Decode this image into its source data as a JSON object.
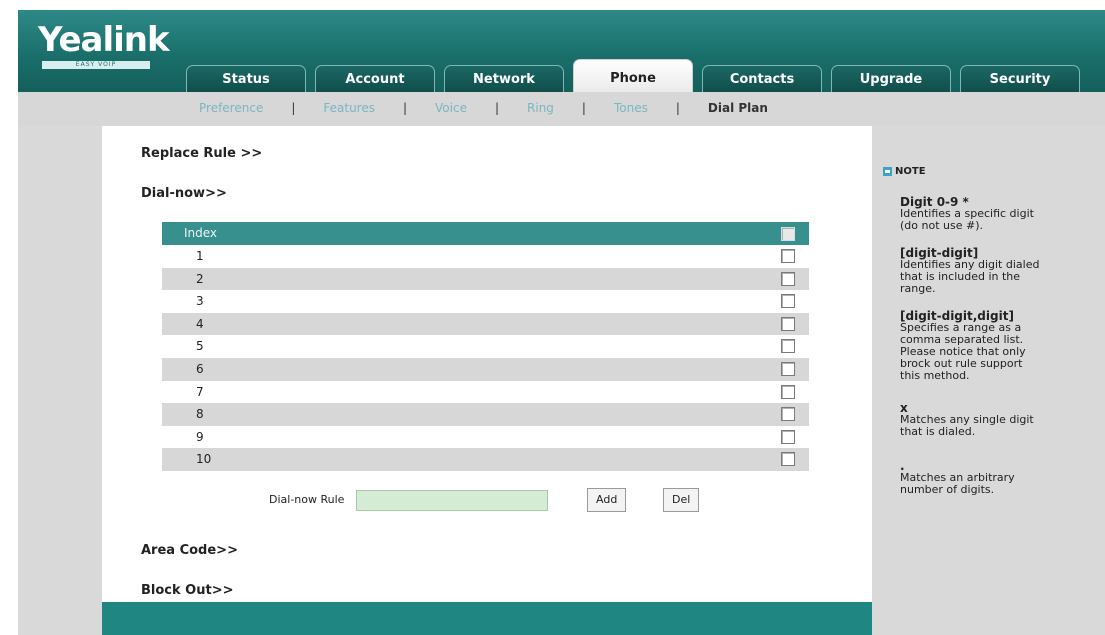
{
  "brand": {
    "logo": "Yealink",
    "tagline": "EASY VOIP"
  },
  "tabs": [
    {
      "label": "Status",
      "active": false
    },
    {
      "label": "Account",
      "active": false
    },
    {
      "label": "Network",
      "active": false
    },
    {
      "label": "Phone",
      "active": true
    },
    {
      "label": "Contacts",
      "active": false
    },
    {
      "label": "Upgrade",
      "active": false
    },
    {
      "label": "Security",
      "active": false
    }
  ],
  "subnav": {
    "items": [
      "Preference",
      "Features",
      "Voice",
      "Ring",
      "Tones",
      "Dial Plan"
    ],
    "separator": "|",
    "active": "Dial Plan"
  },
  "sections": {
    "replace_rule": "Replace Rule >>",
    "dial_now": "Dial-now>>",
    "area_code": "Area Code>>",
    "block_out": "Block Out>>"
  },
  "table": {
    "header_index": "Index",
    "rows": [
      "1",
      "2",
      "3",
      "4",
      "5",
      "6",
      "7",
      "8",
      "9",
      "10"
    ]
  },
  "form": {
    "rule_label": "Dial-now Rule",
    "rule_value": "",
    "add_label": "Add",
    "del_label": "Del"
  },
  "note": {
    "title": "NOTE",
    "entries": [
      {
        "term": "Digit 0-9 *",
        "desc": "Identifies a specific digit\n(do not use #)."
      },
      {
        "term": "[digit-digit]",
        "desc": "Identifies any digit dialed\nthat is included in the\nrange."
      },
      {
        "term": "[digit-digit,digit]",
        "desc": "Specifies a range as a\ncomma separated list.\nPlease notice that only\nbrock out rule support\nthis method."
      },
      {
        "term": "x",
        "desc": "Matches any single digit\nthat is dialed."
      },
      {
        "term": ".",
        "desc": "Matches an arbitrary\nnumber of digits."
      }
    ]
  },
  "colors": {
    "header": "#1a6f6b",
    "table_header": "#38908e",
    "footer": "#1f8682",
    "input_bg": "#d4ebd4",
    "subnav_link": "#7bb6c4"
  }
}
